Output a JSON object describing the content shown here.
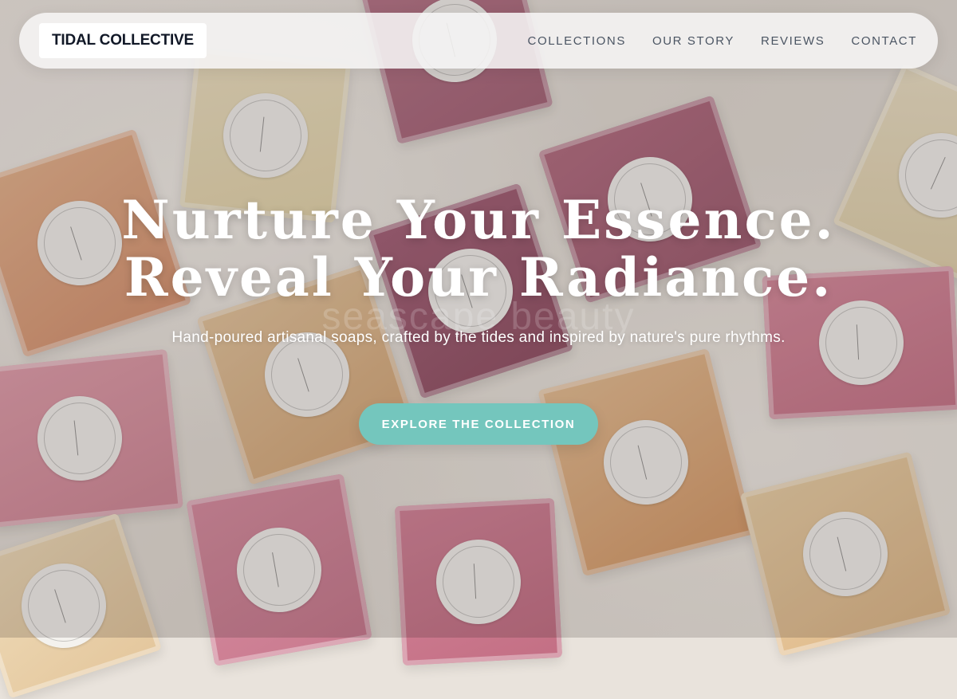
{
  "brand": {
    "name": "TIDAL COLLECTIVE"
  },
  "nav": {
    "items": [
      {
        "label": "COLLECTIONS"
      },
      {
        "label": "OUR STORY"
      },
      {
        "label": "REVIEWS"
      },
      {
        "label": "CONTACT"
      }
    ]
  },
  "hero": {
    "title_line1": "Nurture Your Essence.",
    "title_line2": "Reveal Your Radiance.",
    "subtitle": "Hand-poured artisanal soaps, crafted by the tides and inspired by nature's pure rhythms.",
    "watermark": "seascape beauty",
    "cta_label": "EXPLORE THE COLLECTION"
  },
  "colors": {
    "accent": "#74c6bd",
    "nav_text": "#4b5563",
    "logo_text": "#111827"
  }
}
